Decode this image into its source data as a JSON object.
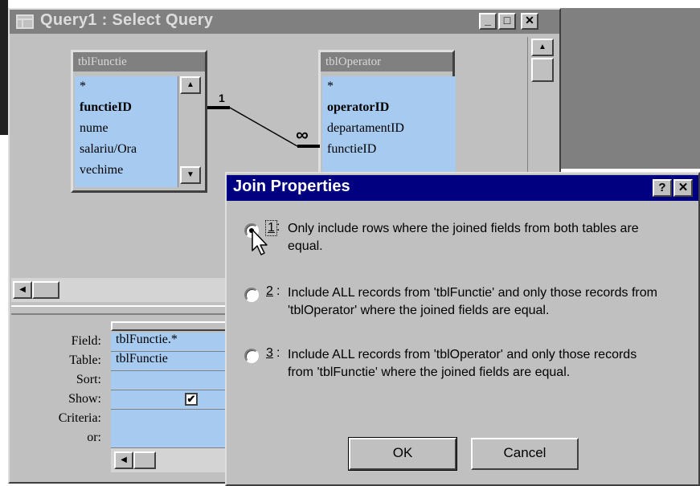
{
  "window": {
    "title": "Query1 : Select Query",
    "minimize_glyph": "_",
    "maximize_glyph": "□",
    "close_glyph": "✕"
  },
  "tables": [
    {
      "title": "tblFunctie",
      "fields": [
        "*",
        "functieID",
        "nume",
        "salariu/Ora",
        "vechime"
      ],
      "key_field": "functieID"
    },
    {
      "title": "tblOperator",
      "fields": [
        "*",
        "operatorID",
        "departamentID",
        "functieID"
      ],
      "key_field": "operatorID"
    }
  ],
  "relationship": {
    "one_label": "1",
    "many_label": "∞"
  },
  "grid": {
    "labels": {
      "field": "Field:",
      "table": "Table:",
      "sort": "Sort:",
      "show": "Show:",
      "criteria": "Criteria:",
      "or": "or:"
    },
    "column1": {
      "field": "tblFunctie.*",
      "table": "tblFunctie",
      "show": "✔"
    }
  },
  "dialog": {
    "title": "Join Properties",
    "help_glyph": "?",
    "close_glyph": "✕",
    "options": [
      {
        "num": "1",
        "text": "Only include rows where the joined fields from both tables are equal.",
        "selected": true
      },
      {
        "num": "2",
        "text": "Include ALL records from 'tblFunctie' and only those records from 'tblOperator' where the joined fields are equal.",
        "selected": false
      },
      {
        "num": "3",
        "text": "Include ALL records from 'tblOperator' and only those records from 'tblFunctie' where the joined fields are equal.",
        "selected": false
      }
    ],
    "ok_label": "OK",
    "cancel_label": "Cancel"
  },
  "colors": {
    "title_active": "#000080",
    "title_inactive": "#808080",
    "list_bg": "#a6caf0",
    "face": "#c0c0c0"
  }
}
